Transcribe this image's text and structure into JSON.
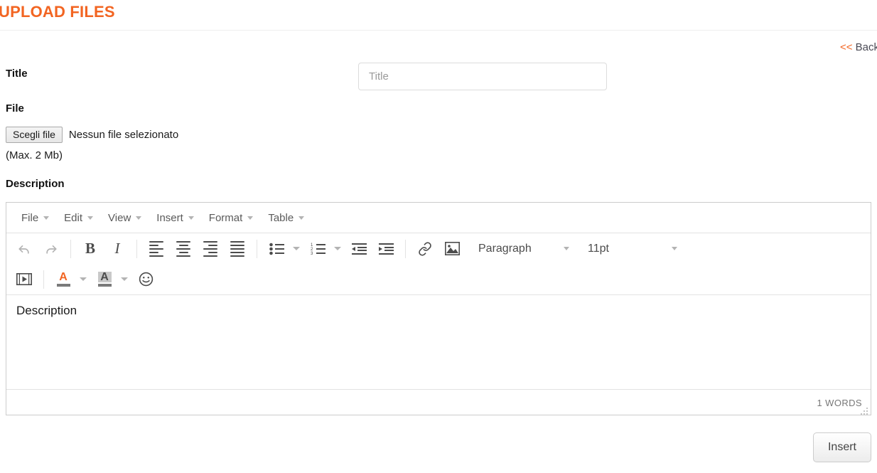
{
  "header": {
    "title": "UPLOAD FILES"
  },
  "back_link": {
    "chevrons": "<<",
    "label": "Back"
  },
  "form": {
    "title_label": "Title",
    "title_placeholder": "Title",
    "title_value": "",
    "file_label": "File",
    "file_button_label": "Scegli file",
    "file_status": "Nessun file selezionato",
    "file_hint": "(Max. 2 Mb)",
    "description_label": "Description"
  },
  "editor": {
    "menubar": [
      {
        "label": "File",
        "icon": "chevron-down-icon"
      },
      {
        "label": "Edit",
        "icon": "chevron-down-icon"
      },
      {
        "label": "View",
        "icon": "chevron-down-icon"
      },
      {
        "label": "Insert",
        "icon": "chevron-down-icon"
      },
      {
        "label": "Format",
        "icon": "chevron-down-icon"
      },
      {
        "label": "Table",
        "icon": "chevron-down-icon"
      }
    ],
    "toolbar_row1": [
      {
        "name": "undo-icon",
        "state": "disabled"
      },
      {
        "name": "redo-icon",
        "state": "disabled"
      },
      {
        "name": "bold-icon",
        "state": "enabled"
      },
      {
        "name": "italic-icon",
        "state": "enabled"
      },
      {
        "name": "align-left-icon",
        "state": "enabled"
      },
      {
        "name": "align-center-icon",
        "state": "enabled"
      },
      {
        "name": "align-right-icon",
        "state": "enabled"
      },
      {
        "name": "align-justify-icon",
        "state": "enabled"
      },
      {
        "name": "bullet-list-icon",
        "state": "enabled"
      },
      {
        "name": "numbered-list-icon",
        "state": "enabled"
      },
      {
        "name": "outdent-icon",
        "state": "enabled"
      },
      {
        "name": "indent-icon",
        "state": "enabled"
      },
      {
        "name": "link-icon",
        "state": "enabled"
      },
      {
        "name": "image-icon",
        "state": "enabled"
      }
    ],
    "toolbar_row2": [
      {
        "name": "media-icon",
        "state": "enabled"
      },
      {
        "name": "text-color-icon",
        "state": "enabled"
      },
      {
        "name": "background-color-icon",
        "state": "enabled"
      },
      {
        "name": "emoticon-icon",
        "state": "enabled"
      }
    ],
    "paragraph_select": "Paragraph",
    "fontsize_select": "11pt",
    "content_text": "Description",
    "wordcount": "1 WORDS"
  },
  "footer": {
    "insert_label": "Insert"
  },
  "colors": {
    "accent": "#f26522",
    "text": "#333333",
    "border": "#cccccc",
    "muted": "#777777"
  }
}
